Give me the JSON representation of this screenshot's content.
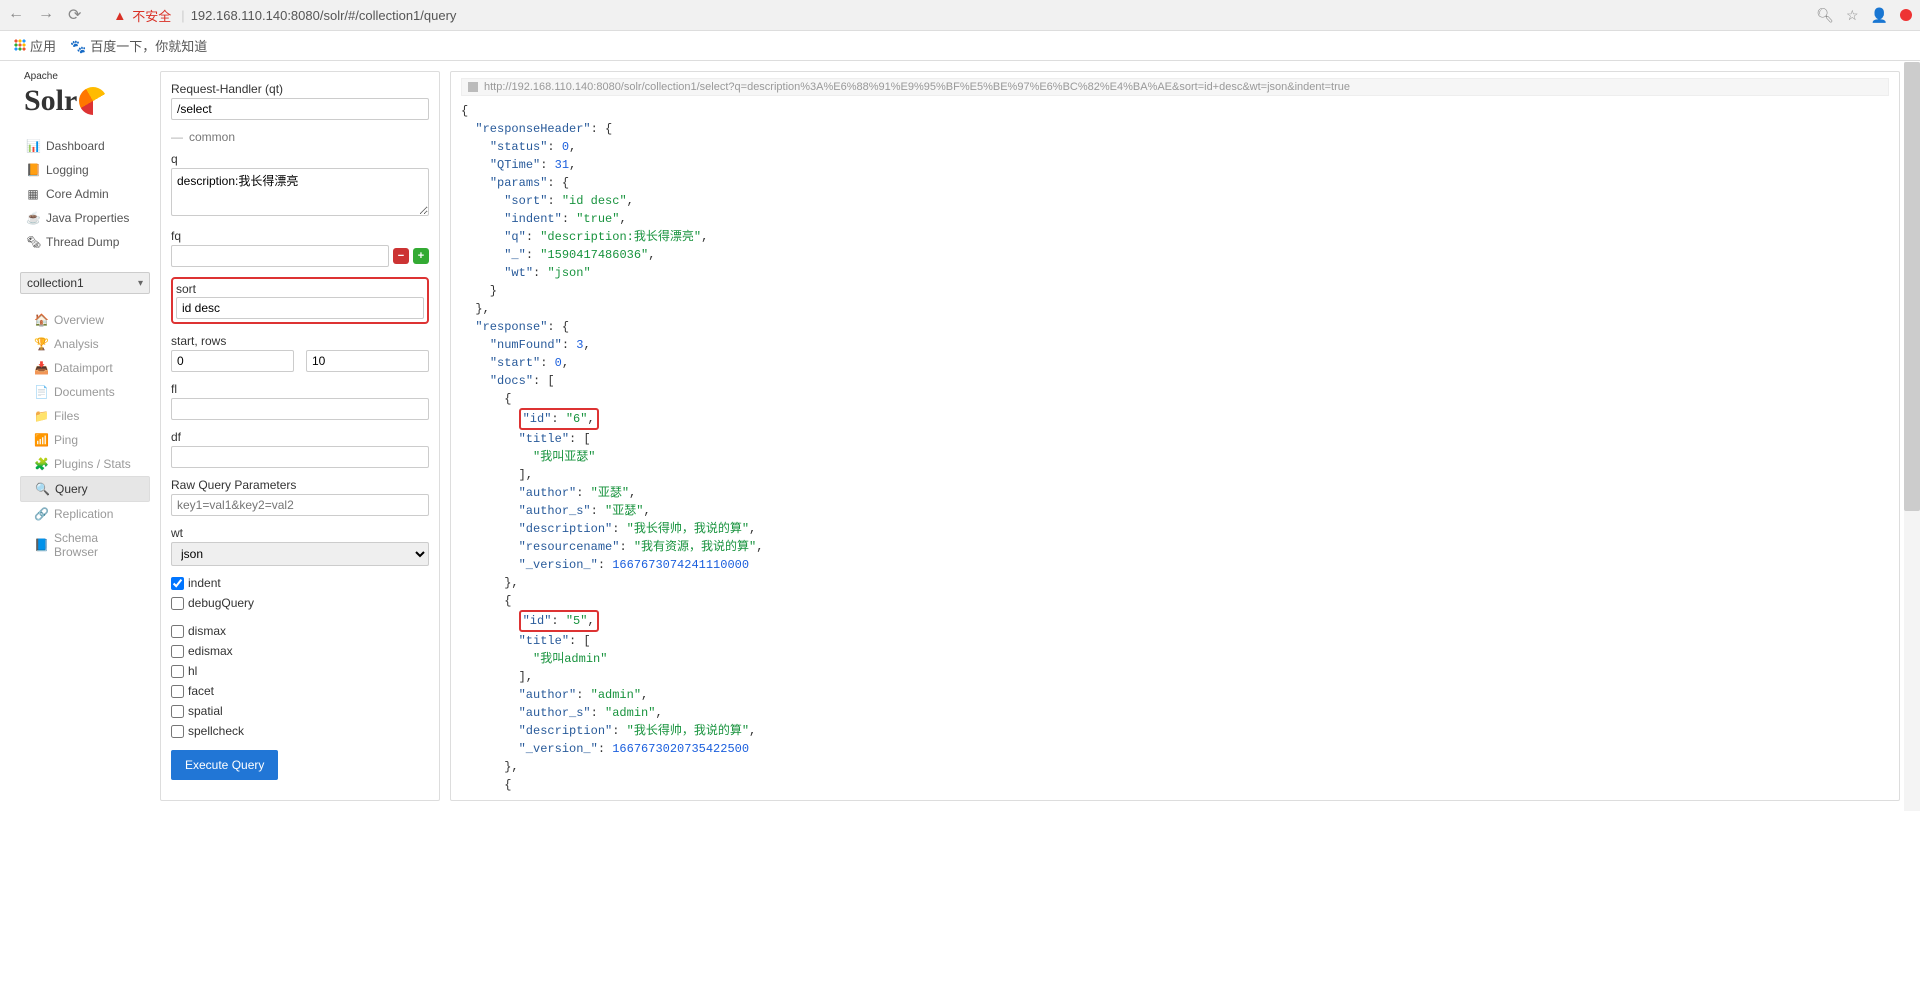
{
  "browser": {
    "unsafe_label": "不安全",
    "url": "192.168.110.140:8080/solr/#/collection1/query",
    "apps_label": "应用",
    "bookmark_baidu": "百度一下，你就知道"
  },
  "logo": {
    "apache": "Apache",
    "solr": "Solr"
  },
  "nav": {
    "dashboard": "Dashboard",
    "logging": "Logging",
    "coreadmin": "Core Admin",
    "javaprops": "Java Properties",
    "threaddump": "Thread Dump"
  },
  "core_selected": "collection1",
  "subnav": {
    "overview": "Overview",
    "analysis": "Analysis",
    "dataimport": "Dataimport",
    "documents": "Documents",
    "files": "Files",
    "ping": "Ping",
    "plugins": "Plugins / Stats",
    "query": "Query",
    "replication": "Replication",
    "schema": "Schema Browser"
  },
  "form": {
    "qt_label": "Request-Handler (qt)",
    "qt_value": "/select",
    "common_label": "common",
    "q_label": "q",
    "q_value": "description:我长得漂亮",
    "fq_label": "fq",
    "fq_value": "",
    "sort_label": "sort",
    "sort_value": "id desc",
    "startrows_label": "start, rows",
    "start_value": "0",
    "rows_value": "10",
    "fl_label": "fl",
    "fl_value": "",
    "df_label": "df",
    "df_value": "",
    "rawq_label": "Raw Query Parameters",
    "rawq_placeholder": "key1=val1&key2=val2",
    "wt_label": "wt",
    "wt_value": "json",
    "indent_label": "indent",
    "debug_label": "debugQuery",
    "dismax_label": "dismax",
    "edismax_label": "edismax",
    "hl_label": "hl",
    "facet_label": "facet",
    "spatial_label": "spatial",
    "spellcheck_label": "spellcheck",
    "execute_label": "Execute Query"
  },
  "result_url": "http://192.168.110.140:8080/solr/collection1/select?q=description%3A%E6%88%91%E9%95%BF%E5%BE%97%E6%BC%82%E4%BA%AE&sort=id+desc&wt=json&indent=true",
  "response": {
    "responseHeader": {
      "status": 0,
      "QTime": 31,
      "params": {
        "sort": "id desc",
        "indent": "true",
        "q": "description:我长得漂亮",
        "_": "1590417486036",
        "wt": "json"
      }
    },
    "response": {
      "numFound": 3,
      "start": 0,
      "docs": [
        {
          "id": "6",
          "title": [
            "我叫亚瑟"
          ],
          "author": "亚瑟",
          "author_s": "亚瑟",
          "description": "我长得帅，我说的算",
          "resourcename": "我有资源，我说的算",
          "_version_": 1667673074241110000
        },
        {
          "id": "5",
          "title": [
            "我叫admin"
          ],
          "author": "admin",
          "author_s": "admin",
          "description": "我长得帅，我说的算",
          "_version_": 1667673020735422500
        }
      ]
    }
  }
}
